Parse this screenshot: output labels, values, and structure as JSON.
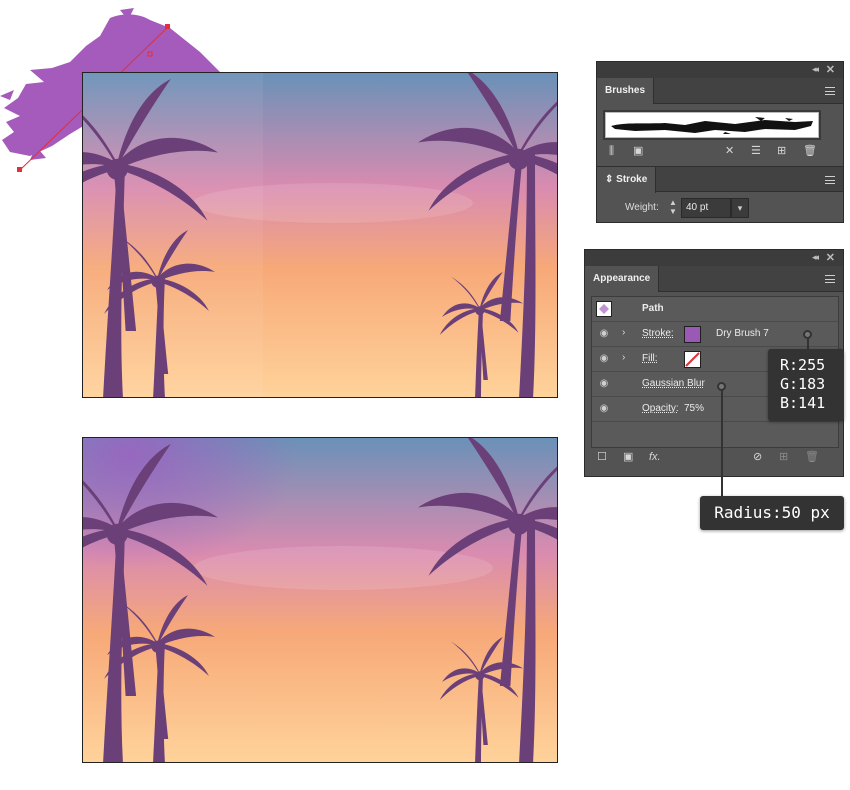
{
  "brushes_panel": {
    "tab_label": "Brushes"
  },
  "stroke_panel": {
    "tab_label": "Stroke",
    "weight_label": "Weight:",
    "weight_value": "40 pt"
  },
  "appearance_panel": {
    "tab_label": "Appearance",
    "rows": {
      "path_label": "Path",
      "stroke_label": "Stroke:",
      "stroke_value": "Dry Brush 7",
      "stroke_color": "#9b59b6",
      "fill_label": "Fill:",
      "fill_value": "none",
      "effect_label": "Gaussian Blur",
      "opacity_label": "Opacity:",
      "opacity_value": "75%"
    }
  },
  "callouts": {
    "rgb": {
      "r_line": "R:255",
      "g_line": "G:183",
      "b_line": "B:141"
    },
    "radius": "Radius:50 px"
  },
  "colors": {
    "brush_purple": "#a45bbb",
    "sky_top": "#6a91b8",
    "sky_mid": "#d98bb0",
    "sky_bottom": "#ffd39b",
    "palm": "#6b3f78"
  },
  "icons": {
    "panel_menu": "hamburger-menu-icon",
    "visibility": "eye-icon",
    "expand": "chevron-right-icon",
    "fx": "fx-icon",
    "new": "new-item-icon",
    "delete": "trash-icon",
    "clear": "no-icon"
  }
}
